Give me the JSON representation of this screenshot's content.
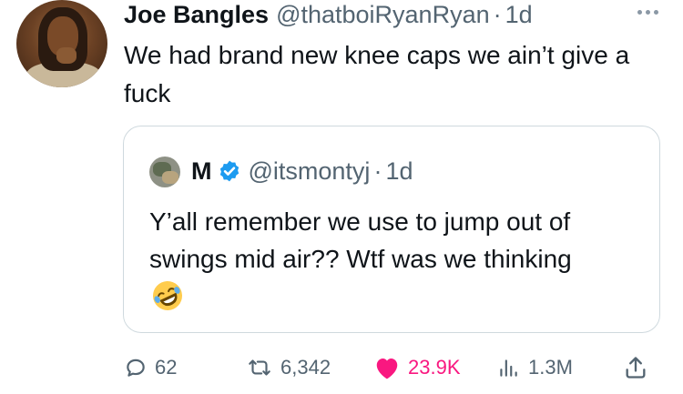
{
  "tweet": {
    "author_name": "Joe Bangles",
    "author_handle": "@thatboiRyanRyan",
    "separator": "·",
    "time": "1d",
    "text": "We had brand new knee caps we ain’t give a fuck",
    "more_icon": "more-horizontal-icon"
  },
  "quoted": {
    "author_name": "M",
    "verified": true,
    "verified_color": "#1d9bf0",
    "author_handle": "@itsmontyj",
    "separator": "·",
    "time": "1d",
    "text": "Y’all remember we use to jump out of swings mid air?? Wtf was we thinking",
    "emoji": "rolling-on-floor-laughing-emoji"
  },
  "actions": {
    "replies": "62",
    "retweets": "6,342",
    "likes": "23.9K",
    "liked": true,
    "like_color": "#f91880",
    "views": "1.3M",
    "icons": [
      "reply-icon",
      "retweet-icon",
      "heart-icon",
      "views-icon",
      "share-icon"
    ]
  }
}
